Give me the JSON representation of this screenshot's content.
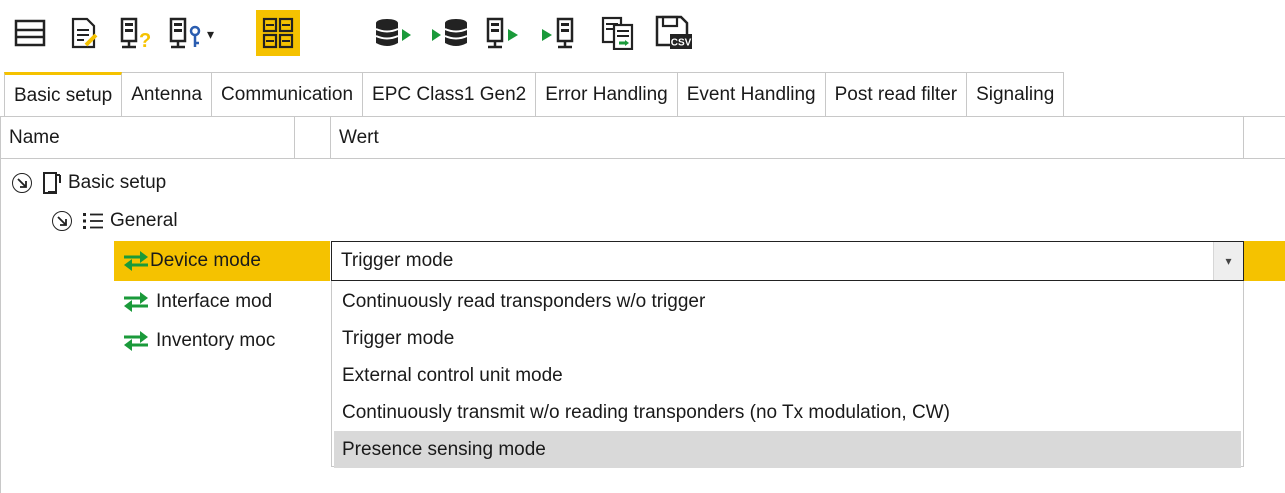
{
  "toolbar": {
    "buttons": [
      {
        "icon": "panel-icon"
      },
      {
        "icon": "document-edit-icon"
      },
      {
        "icon": "reader-query-icon"
      },
      {
        "icon": "reader-key-icon",
        "dropdown": true
      },
      {
        "icon": "grid-view-icon",
        "active": true
      },
      {
        "icon": "database-export-icon"
      },
      {
        "icon": "database-import-icon"
      },
      {
        "icon": "reader-export-icon"
      },
      {
        "icon": "reader-import-icon"
      },
      {
        "icon": "compare-documents-icon"
      },
      {
        "icon": "save-csv-icon"
      }
    ],
    "csv_label": "CSV",
    "query_mark": "?",
    "dropdown_caret": "▾"
  },
  "tabs": [
    {
      "label": "Basic setup",
      "active": true
    },
    {
      "label": "Antenna"
    },
    {
      "label": "Communication"
    },
    {
      "label": "EPC Class1 Gen2"
    },
    {
      "label": "Error Handling"
    },
    {
      "label": "Event Handling"
    },
    {
      "label": "Post read filter"
    },
    {
      "label": "Signaling"
    }
  ],
  "grid": {
    "col_name": "Name",
    "col_value": "Wert"
  },
  "tree": {
    "root": "Basic setup",
    "group": "General",
    "items": [
      {
        "label": "Device mode",
        "selected": true
      },
      {
        "label": "Interface mod"
      },
      {
        "label": "Inventory moc"
      }
    ]
  },
  "combo": {
    "value": "Trigger mode",
    "arrow": "▾",
    "options": [
      "Continuously read transponders w/o trigger",
      "Trigger mode",
      "External control unit mode",
      "Continuously transmit w/o reading transponders (no Tx modulation, CW)",
      "Presence sensing mode"
    ],
    "hovered_index": 4
  },
  "colors": {
    "accent": "#f5c200",
    "green": "#1a9a3a",
    "hover": "#d9d9d9"
  }
}
